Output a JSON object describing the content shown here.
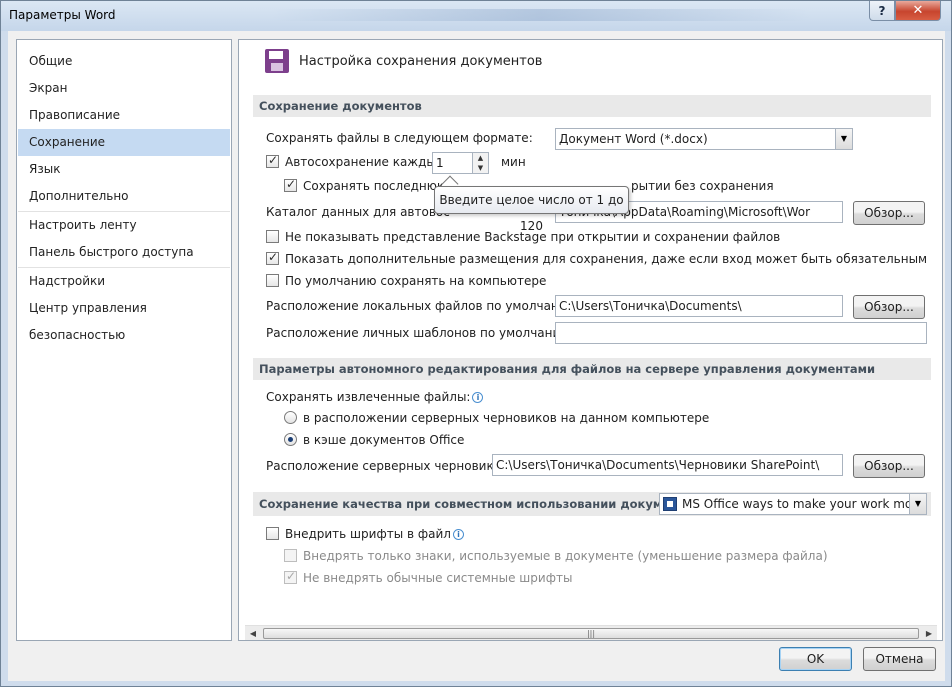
{
  "window": {
    "title": "Параметры Word",
    "help_label": "?",
    "close_label": "✕"
  },
  "nav": {
    "items": [
      {
        "label": "Общие"
      },
      {
        "label": "Экран"
      },
      {
        "label": "Правописание"
      },
      {
        "label": "Сохранение"
      },
      {
        "label": "Язык"
      },
      {
        "label": "Дополнительно"
      },
      {
        "label": "Настроить ленту"
      },
      {
        "label": "Панель быстрого доступа"
      },
      {
        "label": "Надстройки"
      },
      {
        "label": "Центр управления безопасностью"
      }
    ],
    "active": "Сохранение"
  },
  "header": {
    "icon": "save-icon",
    "title": "Настройка сохранения документов"
  },
  "save_section": {
    "title": "Сохранение документов",
    "format_label": "Сохранять файлы в следующем формате:",
    "format_value": "Документ Word (*.docx)",
    "autosave_label": "Автосохранение каждые",
    "autosave_checked": true,
    "autosave_value": "1",
    "autosave_unit": "мин",
    "keep_last_label_left": "Сохранять последнюю",
    "keep_last_label_right": "рытии без сохранения",
    "keep_last_checked": true,
    "tooltip": "Введите целое число от 1 до 120",
    "autorecover_label": "Каталог данных для автовос",
    "autorecover_value": "Тоничка\\AppData\\Roaming\\Microsoft\\Wor",
    "browse_label": "Обзор...",
    "backstage_label": "Не показывать представление Backstage при открытии и сохранении файлов",
    "backstage_checked": false,
    "extra_places_label": "Показать дополнительные размещения для сохранения, даже если вход может быть обязательным",
    "extra_places_checked": true,
    "save_local_label": "По умолчанию сохранять на компьютере",
    "save_local_checked": false,
    "local_files_label": "Расположение локальных файлов по умолчанию:",
    "local_files_value": "C:\\Users\\Тоничка\\Documents\\",
    "templates_label": "Расположение личных шаблонов по умолчанию:",
    "templates_value": ""
  },
  "offline_section": {
    "title": "Параметры автономного редактирования для файлов на сервере управления документами",
    "save_checked_out_label": "Сохранять извлеченные файлы:",
    "radio_server_drafts": "в расположении серверных черновиков на данном компьютере",
    "radio_office_cache": "в кэше документов Office",
    "selected": "в кэше документов Office",
    "server_drafts_label": "Расположение серверных черновиков:",
    "server_drafts_value": "C:\\Users\\Тоничка\\Documents\\Черновики SharePoint\\"
  },
  "fidelity_section": {
    "title": "Сохранение качества при совместном использовании документа:",
    "document_value": "MS Office ways to make your work more...",
    "embed_fonts_label": "Внедрить шрифты в файл",
    "embed_fonts_checked": false,
    "embed_used_only_label": "Внедрять только знаки, используемые в документе (уменьшение размера файла)",
    "embed_used_only_checked": false,
    "no_common_fonts_label": "Не внедрять обычные системные шрифты",
    "no_common_fonts_checked": true
  },
  "footer": {
    "ok_label": "OK",
    "cancel_label": "Отмена"
  },
  "colors": {
    "active_nav": "#c5daf2",
    "section_bg": "#e9e9e9",
    "close_button": "#c7452e",
    "save_icon": "#7d3f8c"
  }
}
